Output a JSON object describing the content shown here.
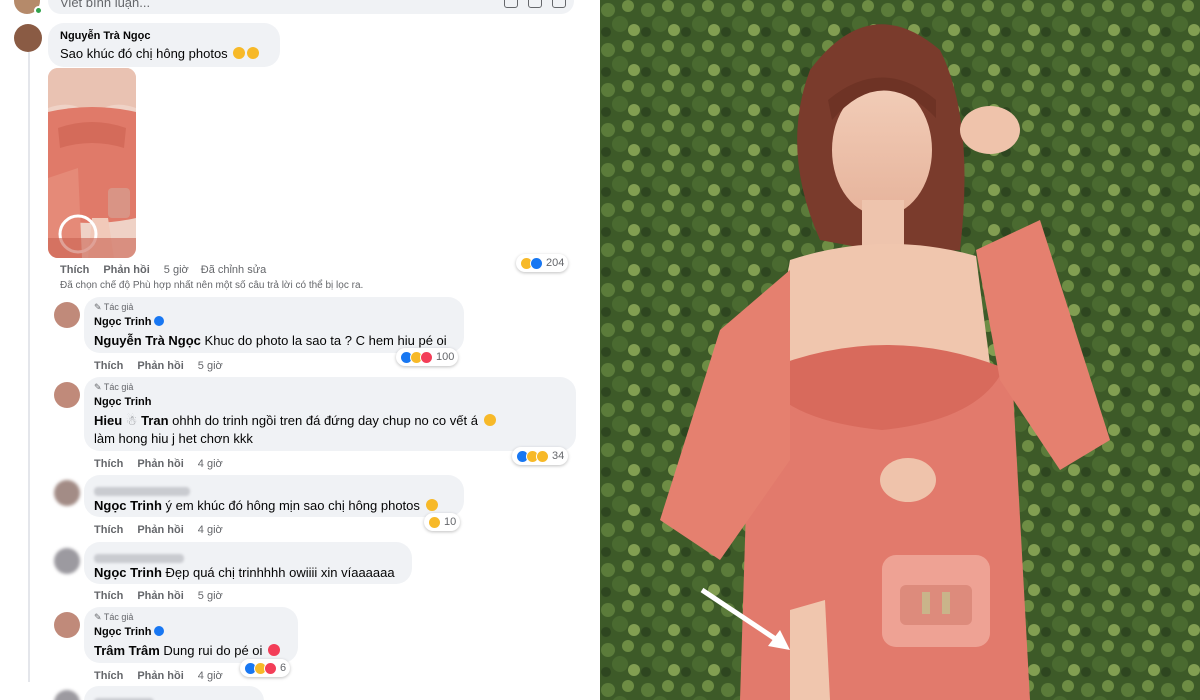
{
  "input": {
    "placeholder": "Viết bình luận..."
  },
  "comment1": {
    "author": "Nguyễn Trà Ngọc",
    "text": "Sao khúc đó chị hông photos",
    "actions": {
      "like": "Thích",
      "reply": "Phản hồi",
      "time": "5 giờ",
      "edited": "Đã chỉnh sửa"
    },
    "reaction_count": "204"
  },
  "filter_note": "Đã chọn chế độ Phù hợp nhất nên một số câu trả lời có thể bị lọc ra.",
  "reply1": {
    "badge": "Tác giả",
    "author": "Ngọc Trinh",
    "mention": "Nguyễn Trà Ngọc",
    "text": "Khuc do photo la sao ta ? C hem hiu pé oi",
    "actions": {
      "like": "Thích",
      "reply": "Phản hồi",
      "time": "5 giờ"
    },
    "reaction_count": "100"
  },
  "reply2": {
    "badge": "Tác giả",
    "author": "Ngọc Trinh",
    "mention_first": "Hieu",
    "mention_last": "Tran",
    "text_line1": "ohhh do trinh ngồi tren đá đứng day chup no co vết á",
    "text_line2": "làm hong hiu j het chơn kkk",
    "actions": {
      "like": "Thích",
      "reply": "Phản hồi",
      "time": "4 giờ"
    },
    "reaction_count": "34"
  },
  "reply3": {
    "author_blurred": "Nguyễn Trà Ngọc",
    "mention": "Ngọc Trinh",
    "text": "ý em khúc đó hông mịn sao chị hông photos",
    "actions": {
      "like": "Thích",
      "reply": "Phản hồi",
      "time": "4 giờ"
    },
    "reaction_count": "10"
  },
  "reply4": {
    "author_blurred": "Trần Ngọc Tuyền",
    "mention": "Ngọc Trinh",
    "text": "Đẹp quá chị trinhhhh owiiii xin víaaaaaa",
    "actions": {
      "like": "Thích",
      "reply": "Phản hồi",
      "time": "5 giờ"
    }
  },
  "reply5": {
    "badge": "Tác giả",
    "author": "Ngọc Trinh",
    "mention": "Trâm Trâm",
    "text": "Dung rui do pé oi",
    "actions": {
      "like": "Thích",
      "reply": "Phản hồi",
      "time": "4 giờ"
    },
    "reaction_count": "6"
  },
  "reply6": {
    "author_blurred": "Sâm Hân"
  },
  "colors": {
    "bubble": "#f0f2f5",
    "meta": "#65676b",
    "like": "#1877f2",
    "dress": "#e27a6c",
    "hedge": "#3f5a2a"
  }
}
